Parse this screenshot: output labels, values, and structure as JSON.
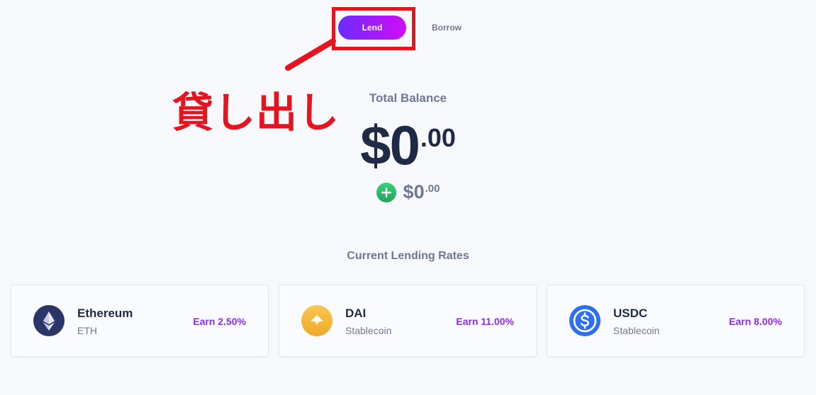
{
  "toggle": {
    "lend_label": "Lend",
    "borrow_label": "Borrow"
  },
  "annotation": {
    "text": "貸し出し",
    "color": "#e5141f"
  },
  "balance": {
    "label": "Total Balance",
    "main": "$0",
    "cents": ".00",
    "change_main": "$0",
    "change_cents": ".00",
    "change_icon": "plus-circle-icon"
  },
  "rates": {
    "title": "Current Lending Rates",
    "cards": [
      {
        "name": "Ethereum",
        "sub": "ETH",
        "earn": "Earn 2.50%",
        "icon": "ethereum-icon"
      },
      {
        "name": "DAI",
        "sub": "Stablecoin",
        "earn": "Earn 11.00%",
        "icon": "dai-icon"
      },
      {
        "name": "USDC",
        "sub": "Stablecoin",
        "earn": "Earn 8.00%",
        "icon": "usdc-icon"
      }
    ]
  },
  "colors": {
    "accent_start": "#6a2cff",
    "accent_end": "#d10cf7",
    "earn": "#8a2cf0",
    "positive": "#2bbf6a"
  }
}
